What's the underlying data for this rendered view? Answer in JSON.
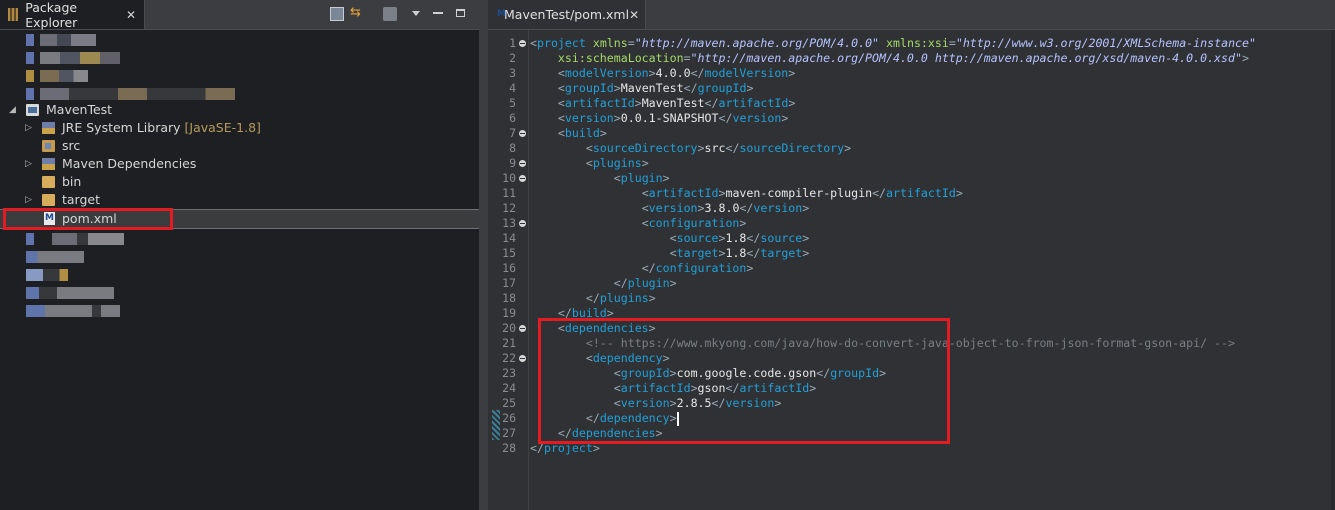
{
  "explorer": {
    "title": "Package Explorer",
    "project": "MavenTest",
    "items": [
      {
        "label": "JRE System Library",
        "suffix": " [JavaSE-1.8]"
      },
      {
        "label": "src",
        "suffix": ""
      },
      {
        "label": "Maven Dependencies",
        "suffix": ""
      },
      {
        "label": "bin",
        "suffix": ""
      },
      {
        "label": "target",
        "suffix": ""
      },
      {
        "label": "pom.xml",
        "suffix": ""
      }
    ]
  },
  "editor": {
    "tab_title": "MavenTest/pom.xml",
    "lines": [
      {
        "n": "1",
        "fold": true,
        "tokens": [
          [
            "b",
            "<"
          ],
          [
            "tg",
            "project"
          ],
          [
            "tx",
            " "
          ],
          [
            "at",
            "xmlns"
          ],
          [
            "b",
            "="
          ],
          [
            "av",
            "\"http://maven.apache.org/POM/4.0.0\""
          ],
          [
            "tx",
            " "
          ],
          [
            "at",
            "xmlns:xsi"
          ],
          [
            "b",
            "="
          ],
          [
            "av",
            "\"http://www.w3.org/2001/XMLSchema-instance\""
          ]
        ]
      },
      {
        "n": "2",
        "fold": false,
        "tokens": [
          [
            "tx",
            "    "
          ],
          [
            "at",
            "xsi:schemaLocation"
          ],
          [
            "b",
            "="
          ],
          [
            "av",
            "\"http://maven.apache.org/POM/4.0.0 http://maven.apache.org/xsd/maven-4.0.0.xsd\""
          ],
          [
            "b",
            ">"
          ]
        ]
      },
      {
        "n": "3",
        "fold": false,
        "tokens": [
          [
            "tx",
            "    "
          ],
          [
            "b",
            "<"
          ],
          [
            "tg",
            "modelVersion"
          ],
          [
            "b",
            ">"
          ],
          [
            "tx",
            "4.0.0"
          ],
          [
            "b",
            "</"
          ],
          [
            "tg",
            "modelVersion"
          ],
          [
            "b",
            ">"
          ]
        ]
      },
      {
        "n": "4",
        "fold": false,
        "tokens": [
          [
            "tx",
            "    "
          ],
          [
            "b",
            "<"
          ],
          [
            "tg",
            "groupId"
          ],
          [
            "b",
            ">"
          ],
          [
            "tx",
            "MavenTest"
          ],
          [
            "b",
            "</"
          ],
          [
            "tg",
            "groupId"
          ],
          [
            "b",
            ">"
          ]
        ]
      },
      {
        "n": "5",
        "fold": false,
        "tokens": [
          [
            "tx",
            "    "
          ],
          [
            "b",
            "<"
          ],
          [
            "tg",
            "artifactId"
          ],
          [
            "b",
            ">"
          ],
          [
            "tx",
            "MavenTest"
          ],
          [
            "b",
            "</"
          ],
          [
            "tg",
            "artifactId"
          ],
          [
            "b",
            ">"
          ]
        ]
      },
      {
        "n": "6",
        "fold": false,
        "tokens": [
          [
            "tx",
            "    "
          ],
          [
            "b",
            "<"
          ],
          [
            "tg",
            "version"
          ],
          [
            "b",
            ">"
          ],
          [
            "tx",
            "0.0.1-SNAPSHOT"
          ],
          [
            "b",
            "</"
          ],
          [
            "tg",
            "version"
          ],
          [
            "b",
            ">"
          ]
        ]
      },
      {
        "n": "7",
        "fold": true,
        "tokens": [
          [
            "tx",
            "    "
          ],
          [
            "b",
            "<"
          ],
          [
            "tg",
            "build"
          ],
          [
            "b",
            ">"
          ]
        ]
      },
      {
        "n": "8",
        "fold": false,
        "tokens": [
          [
            "tx",
            "        "
          ],
          [
            "b",
            "<"
          ],
          [
            "tg",
            "sourceDirectory"
          ],
          [
            "b",
            ">"
          ],
          [
            "tx",
            "src"
          ],
          [
            "b",
            "</"
          ],
          [
            "tg",
            "sourceDirectory"
          ],
          [
            "b",
            ">"
          ]
        ]
      },
      {
        "n": "9",
        "fold": true,
        "tokens": [
          [
            "tx",
            "        "
          ],
          [
            "b",
            "<"
          ],
          [
            "tg",
            "plugins"
          ],
          [
            "b",
            ">"
          ]
        ]
      },
      {
        "n": "10",
        "fold": true,
        "tokens": [
          [
            "tx",
            "            "
          ],
          [
            "b",
            "<"
          ],
          [
            "tg",
            "plugin"
          ],
          [
            "b",
            ">"
          ]
        ]
      },
      {
        "n": "11",
        "fold": false,
        "tokens": [
          [
            "tx",
            "                "
          ],
          [
            "b",
            "<"
          ],
          [
            "tg",
            "artifactId"
          ],
          [
            "b",
            ">"
          ],
          [
            "tx",
            "maven-compiler-plugin"
          ],
          [
            "b",
            "</"
          ],
          [
            "tg",
            "artifactId"
          ],
          [
            "b",
            ">"
          ]
        ]
      },
      {
        "n": "12",
        "fold": false,
        "tokens": [
          [
            "tx",
            "                "
          ],
          [
            "b",
            "<"
          ],
          [
            "tg",
            "version"
          ],
          [
            "b",
            ">"
          ],
          [
            "tx",
            "3.8.0"
          ],
          [
            "b",
            "</"
          ],
          [
            "tg",
            "version"
          ],
          [
            "b",
            ">"
          ]
        ]
      },
      {
        "n": "13",
        "fold": true,
        "tokens": [
          [
            "tx",
            "                "
          ],
          [
            "b",
            "<"
          ],
          [
            "tg",
            "configuration"
          ],
          [
            "b",
            ">"
          ]
        ]
      },
      {
        "n": "14",
        "fold": false,
        "tokens": [
          [
            "tx",
            "                    "
          ],
          [
            "b",
            "<"
          ],
          [
            "tg",
            "source"
          ],
          [
            "b",
            ">"
          ],
          [
            "tx",
            "1.8"
          ],
          [
            "b",
            "</"
          ],
          [
            "tg",
            "source"
          ],
          [
            "b",
            ">"
          ]
        ]
      },
      {
        "n": "15",
        "fold": false,
        "tokens": [
          [
            "tx",
            "                    "
          ],
          [
            "b",
            "<"
          ],
          [
            "tg",
            "target"
          ],
          [
            "b",
            ">"
          ],
          [
            "tx",
            "1.8"
          ],
          [
            "b",
            "</"
          ],
          [
            "tg",
            "target"
          ],
          [
            "b",
            ">"
          ]
        ]
      },
      {
        "n": "16",
        "fold": false,
        "tokens": [
          [
            "tx",
            "                "
          ],
          [
            "b",
            "</"
          ],
          [
            "tg",
            "configuration"
          ],
          [
            "b",
            ">"
          ]
        ]
      },
      {
        "n": "17",
        "fold": false,
        "tokens": [
          [
            "tx",
            "            "
          ],
          [
            "b",
            "</"
          ],
          [
            "tg",
            "plugin"
          ],
          [
            "b",
            ">"
          ]
        ]
      },
      {
        "n": "18",
        "fold": false,
        "tokens": [
          [
            "tx",
            "        "
          ],
          [
            "b",
            "</"
          ],
          [
            "tg",
            "plugins"
          ],
          [
            "b",
            ">"
          ]
        ]
      },
      {
        "n": "19",
        "fold": false,
        "tokens": [
          [
            "tx",
            "    "
          ],
          [
            "b",
            "</"
          ],
          [
            "tg",
            "build"
          ],
          [
            "b",
            ">"
          ]
        ]
      },
      {
        "n": "20",
        "fold": true,
        "tokens": [
          [
            "tx",
            "    "
          ],
          [
            "b",
            "<"
          ],
          [
            "tg",
            "dependencies"
          ],
          [
            "b",
            ">"
          ]
        ]
      },
      {
        "n": "21",
        "fold": false,
        "tokens": [
          [
            "tx",
            "        "
          ],
          [
            "cm",
            "<!-- https://www.mkyong.com/java/how-do-convert-java-object-to-from-json-format-gson-api/ -->"
          ]
        ]
      },
      {
        "n": "22",
        "fold": true,
        "tokens": [
          [
            "tx",
            "        "
          ],
          [
            "b",
            "<"
          ],
          [
            "tg",
            "dependency"
          ],
          [
            "b",
            ">"
          ]
        ]
      },
      {
        "n": "23",
        "fold": false,
        "tokens": [
          [
            "tx",
            "            "
          ],
          [
            "b",
            "<"
          ],
          [
            "tg",
            "groupId"
          ],
          [
            "b",
            ">"
          ],
          [
            "tx",
            "com.google.code.gson"
          ],
          [
            "b",
            "</"
          ],
          [
            "tg",
            "groupId"
          ],
          [
            "b",
            ">"
          ]
        ]
      },
      {
        "n": "24",
        "fold": false,
        "tokens": [
          [
            "tx",
            "            "
          ],
          [
            "b",
            "<"
          ],
          [
            "tg",
            "artifactId"
          ],
          [
            "b",
            ">"
          ],
          [
            "tx",
            "gson"
          ],
          [
            "b",
            "</"
          ],
          [
            "tg",
            "artifactId"
          ],
          [
            "b",
            ">"
          ]
        ]
      },
      {
        "n": "25",
        "fold": false,
        "tokens": [
          [
            "tx",
            "            "
          ],
          [
            "b",
            "<"
          ],
          [
            "tg",
            "version"
          ],
          [
            "b",
            ">"
          ],
          [
            "tx",
            "2.8.5"
          ],
          [
            "b",
            "</"
          ],
          [
            "tg",
            "version"
          ],
          [
            "b",
            ">"
          ]
        ]
      },
      {
        "n": "26",
        "fold": false,
        "tokens": [
          [
            "tx",
            "        "
          ],
          [
            "b",
            "</"
          ],
          [
            "tg",
            "dependency"
          ],
          [
            "b",
            ">"
          ]
        ]
      },
      {
        "n": "27",
        "fold": false,
        "tokens": [
          [
            "tx",
            "    "
          ],
          [
            "b",
            "</"
          ],
          [
            "tg",
            "dependencies"
          ],
          [
            "b",
            ">"
          ]
        ]
      },
      {
        "n": "28",
        "fold": false,
        "tokens": [
          [
            "b",
            "</"
          ],
          [
            "tg",
            "project"
          ],
          [
            "b",
            ">"
          ]
        ]
      }
    ]
  }
}
